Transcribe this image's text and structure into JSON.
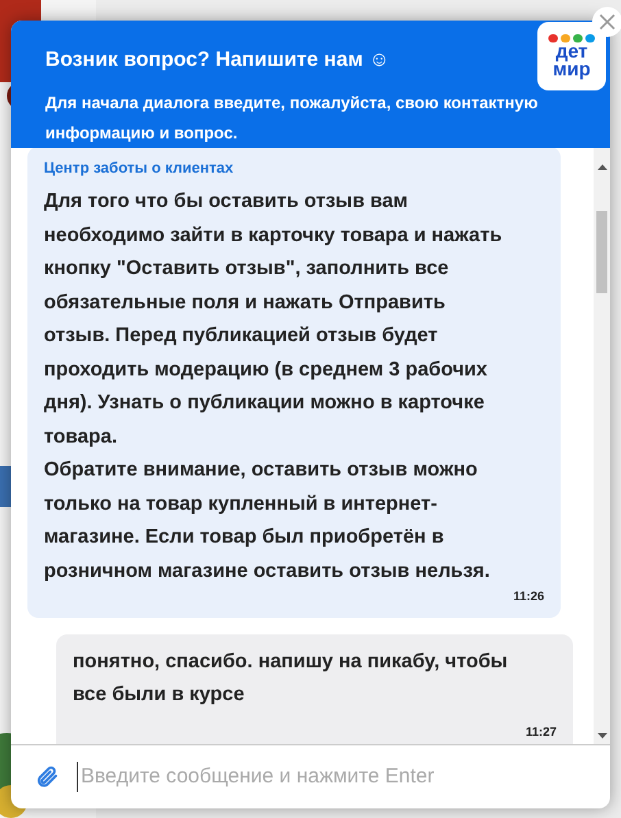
{
  "header": {
    "title": "Возник вопрос? Напишите нам ☺",
    "subtitle": "Для начала диалога введите, пожалуйста, свою контактную информацию и вопрос.",
    "logo": {
      "line_1": "дет",
      "line_2": "мир"
    }
  },
  "messages": [
    {
      "kind": "agent",
      "sender": "Центр заботы о клиентах",
      "text": "Для того что бы оставить отзыв вам необходимо зайти в карточку товара и нажать кнопку \"Оставить отзыв\", заполнить все обязательные поля и нажать Отправить отзыв. Перед публикацией отзыв будет проходить модерацию (в среднем 3 рабочих дня). Узнать о публикации можно в карточке товара.\nОбратите внимание, оставить отзыв можно только на товар купленный в интернет-магазине. Если товар был приобретён в розничном магазине оставить отзыв нельзя.",
      "time": "11:26"
    },
    {
      "kind": "user",
      "text": "понятно, спасибо. напишу на пикабу, чтобы все были в курсе",
      "time": "11:27"
    }
  ],
  "composer": {
    "placeholder": "Введите сообщение и нажмите Enter"
  }
}
